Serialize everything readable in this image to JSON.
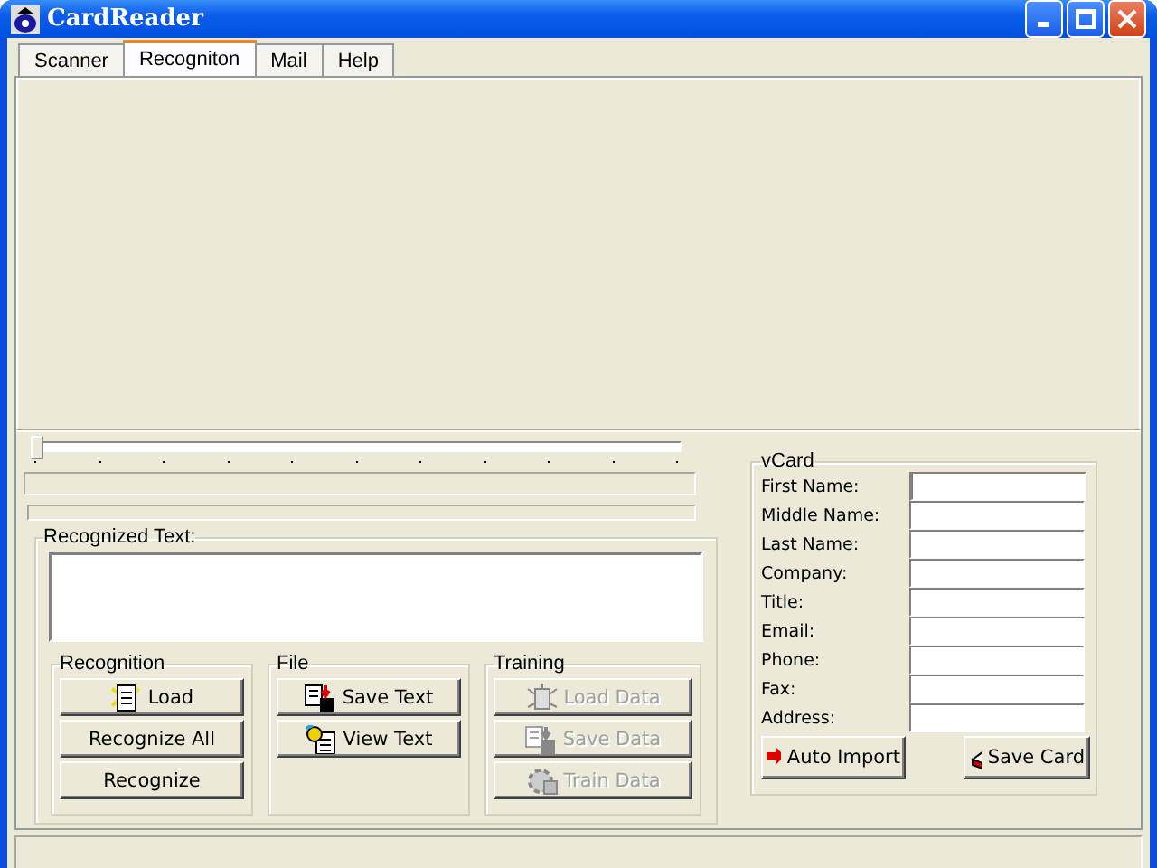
{
  "window": {
    "title": "CardReader"
  },
  "tabs": [
    {
      "label": "Scanner",
      "selected": false
    },
    {
      "label": "Recogniton",
      "selected": true
    },
    {
      "label": "Mail",
      "selected": false
    },
    {
      "label": "Help",
      "selected": false
    }
  ],
  "slider": {
    "level": 0
  },
  "progress_bars": [
    {
      "level": 0
    },
    {
      "level": 0
    }
  ],
  "recognized_text": {
    "label": "Recognized Text:"
  },
  "groups": [
    {
      "title": "Recognition",
      "buttons": [
        {
          "label": "Load",
          "kind": "load",
          "disabled": false
        },
        {
          "label": "Recognize All",
          "disabled": false
        },
        {
          "label": "Recognize",
          "disabled": false
        }
      ]
    },
    {
      "title": "File",
      "buttons": [
        {
          "label": "Save Text",
          "kind": "save",
          "disabled": false
        },
        {
          "label": "View Text",
          "kind": "view",
          "disabled": false
        }
      ]
    },
    {
      "title": "Training",
      "buttons": [
        {
          "label": "Load Data",
          "kind": "bug",
          "disabled": true
        },
        {
          "label": "Save Data",
          "kind": "save",
          "disabled": true
        },
        {
          "label": "Train Data",
          "kind": "train",
          "disabled": true
        }
      ]
    }
  ],
  "vcard": {
    "title": "vCard",
    "fields": [
      {
        "label": "First Name:"
      },
      {
        "label": "Middle Name:"
      },
      {
        "label": "Last Name:"
      },
      {
        "label": "Company:"
      },
      {
        "label": "Title:"
      },
      {
        "label": "Email:"
      },
      {
        "label": "Phone:"
      },
      {
        "label": "Fax:"
      },
      {
        "label": "Address:"
      }
    ],
    "buttons": [
      {
        "label": "Auto Import",
        "kind": "import"
      },
      {
        "label": "Save Card",
        "kind": "card"
      }
    ]
  }
}
